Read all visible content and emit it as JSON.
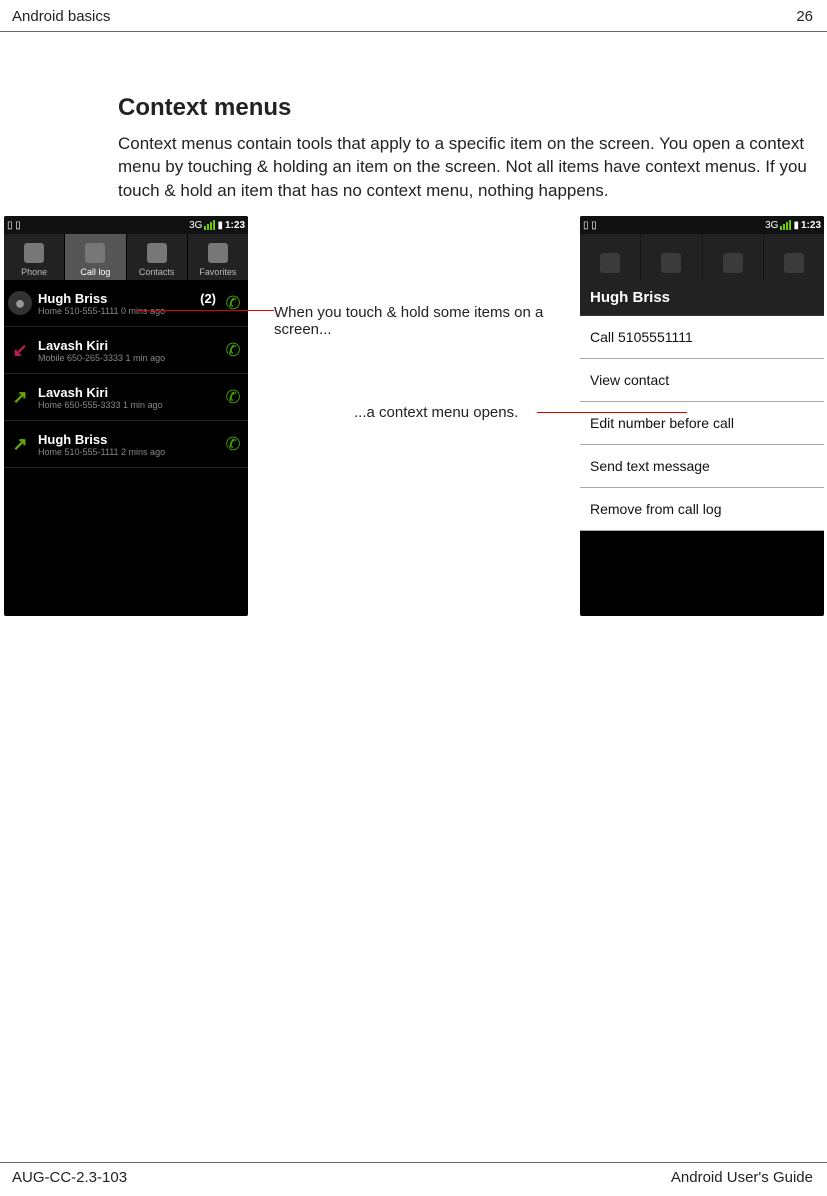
{
  "header": {
    "title": "Android basics",
    "page": "26"
  },
  "section": {
    "heading": "Context menus",
    "intro": "Context menus contain tools that apply to a specific item on the screen. You open a context menu by touching & holding an item on the screen. Not all items have context menus. If you touch & hold an item that has no context menu, nothing happens."
  },
  "left_phone": {
    "status": {
      "time": "1:23",
      "carrier": "3G"
    },
    "tabs": [
      {
        "label": "Phone"
      },
      {
        "label": "Call log"
      },
      {
        "label": "Contacts"
      },
      {
        "label": "Favorites"
      }
    ],
    "calls": [
      {
        "name": "Hugh Briss",
        "count": "(2)",
        "line": "Home  510-555-1111   0 mins ago",
        "dir": "in"
      },
      {
        "name": "Lavash Kiri",
        "count": "",
        "line": "Mobile  650-265-3333   1 min ago",
        "dir": "missed"
      },
      {
        "name": "Lavash Kiri",
        "count": "",
        "line": "Home  650-555-3333   1 min ago",
        "dir": "out"
      },
      {
        "name": "Hugh Briss",
        "count": "",
        "line": "Home  510-555-1111   2 mins ago",
        "dir": "out"
      }
    ]
  },
  "right_phone": {
    "status": {
      "time": "1:23",
      "carrier": "3G"
    },
    "context_title": "Hugh Briss",
    "context_items": [
      "Call 5105551111",
      "View contact",
      "Edit number before call",
      "Send text message",
      "Remove from call log"
    ]
  },
  "annotations": {
    "a1": "When you touch & hold some items on a screen...",
    "a2": "...a context menu opens."
  },
  "footer": {
    "left": "AUG-CC-2.3-103",
    "right": "Android User's Guide"
  },
  "icons": {
    "dir_missed": "↙",
    "dir_out": "↗",
    "dir_in": "●",
    "call": "✆",
    "sig_3g": "3G"
  }
}
